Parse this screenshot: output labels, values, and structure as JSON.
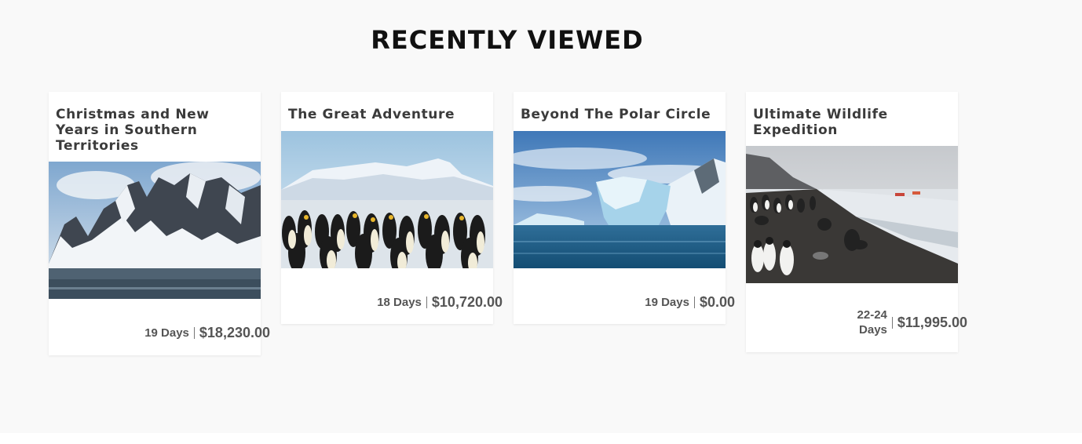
{
  "section": {
    "heading": "RECENTLY VIEWED"
  },
  "tours": [
    {
      "title": "Christmas and New Years in Southern Territories",
      "days": "19 Days",
      "price": "$18,230.00",
      "image": "snowy-mountains-photo"
    },
    {
      "title": "The Great Adventure",
      "days": "18 Days",
      "price": "$10,720.00",
      "image": "emperor-penguins-photo"
    },
    {
      "title": "Beyond The Polar Circle",
      "days": "19 Days",
      "price": "$0.00",
      "image": "iceberg-photo"
    },
    {
      "title": "Ultimate Wildlife Expedition",
      "days": "22-24 Days",
      "price": "$11,995.00",
      "image": "beach-penguins-seals-photo"
    }
  ]
}
